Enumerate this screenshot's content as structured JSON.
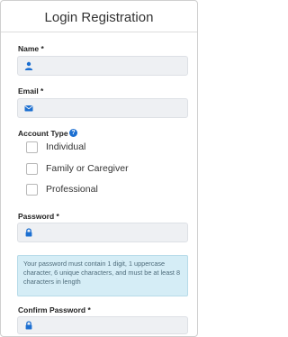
{
  "form": {
    "title": "Login Registration",
    "name_label": "Name *",
    "email_label": "Email *",
    "account_type_label": "Account Type *",
    "account_types": [
      "Individual",
      "Family or Caregiver",
      "Professional"
    ],
    "password_label": "Password *",
    "password_hint": "Your password must contain 1 digit, 1 uppercase character, 6 unique characters, and must be at least 8 characters in length",
    "confirm_password_label": "Confirm Password *"
  },
  "colors": {
    "accent": "#1c6fd1",
    "field_bg": "#eef0f3",
    "info_bg": "#d5edf6"
  },
  "icons": {
    "name_field": "person-icon",
    "email_field": "envelope-icon",
    "password_field": "lock-icon",
    "account_type_help": "question-icon"
  }
}
